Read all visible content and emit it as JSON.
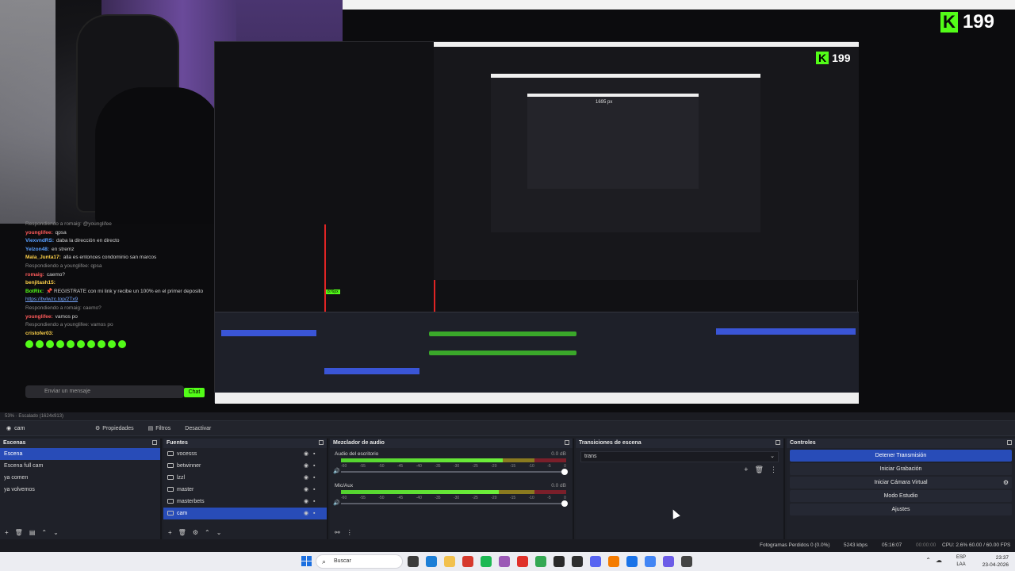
{
  "kick": {
    "count": "199"
  },
  "nested": {
    "size_label": "1695 px",
    "mini_count": "199",
    "chat_badge": "876px"
  },
  "chat": {
    "messages": [
      {
        "kind": "reply",
        "text": "Respondiendo a romaig: @younglifee"
      },
      {
        "kind": "msg",
        "user": "younglifee:",
        "text": "qpsa",
        "cls": "user-r"
      },
      {
        "kind": "msg",
        "user": "ViexvndRS:",
        "text": "daba la dirección en directo",
        "cls": "user-b"
      },
      {
        "kind": "msg",
        "user": "Yelzon48:",
        "text": "en stremz",
        "cls": "user-b"
      },
      {
        "kind": "msg",
        "user": "Mala_Junta17:",
        "text": "alla es entonces condominio san marcos",
        "cls": "user-y"
      },
      {
        "kind": "reply",
        "text": "Respondiendo a younglifee: qpsa"
      },
      {
        "kind": "msg",
        "user": "romaig:",
        "text": "caemo?",
        "cls": "user-r"
      },
      {
        "kind": "msg",
        "user": "benjitash15:",
        "text": "",
        "cls": "user-y"
      },
      {
        "kind": "msg",
        "user": "BotRix:",
        "text": "📌 REGISTRATE con mi link y recibe un 100% en el primer deposito",
        "cls": "user"
      },
      {
        "kind": "link",
        "text": "https://bvlwzc.top/2Tx9"
      },
      {
        "kind": "reply",
        "text": "Respondiendo a romaig: caemo?"
      },
      {
        "kind": "msg",
        "user": "younglifee:",
        "text": "vamos po",
        "cls": "user-r"
      },
      {
        "kind": "reply",
        "text": "Respondiendo a younglifee: vamos po"
      },
      {
        "kind": "msg",
        "user": "cristofer03:",
        "text": "",
        "cls": "user-y"
      }
    ],
    "input_placeholder": "Enviar un mensaje",
    "send_label": "Chat"
  },
  "status_strip": "53%  ·  Escalado (1624x913)",
  "props_bar": {
    "source": "cam",
    "properties": "Propiedades",
    "filters": "Filtros",
    "deactivate": "Desactivar"
  },
  "scenes": {
    "title": "Escenas",
    "items": [
      "Escena",
      "Escena full cam",
      "ya comen",
      "ya volvemos"
    ],
    "selected": 0
  },
  "sources": {
    "title": "Fuentes",
    "items": [
      "vocesss",
      "betwinner",
      "lzzl",
      "master",
      "masterbets",
      "cam"
    ],
    "selected": 5
  },
  "mixer": {
    "title": "Mezclador de audio",
    "channels": [
      {
        "name": "Audio del escritorio",
        "db": "0.0 dB",
        "level": 0.72
      },
      {
        "name": "Mic/Aux",
        "db": "0.0 dB",
        "level": 0.7
      }
    ],
    "ticks": [
      "-60",
      "-55",
      "-50",
      "-45",
      "-40",
      "-35",
      "-30",
      "-25",
      "-20",
      "-15",
      "-10",
      "-5",
      "0"
    ]
  },
  "transitions": {
    "title": "Transiciones de escena",
    "selected": "trans"
  },
  "controls": {
    "title": "Controles",
    "buttons": [
      "Detener Transmisión",
      "Iniciar Grabación",
      "Iniciar Cámara Virtual",
      "Modo Estudio",
      "Ajustes"
    ]
  },
  "statusbar": {
    "frames": "Fotogramas Perdidos 0 (0.0%)",
    "kbps": "5243 kbps",
    "time": "05:16:07",
    "rec": "00:00:00",
    "cpu": "CPU: 2.6%",
    "fps": "60.00 / 60.00 FPS"
  },
  "taskbar": {
    "search": "Buscar",
    "lang_top": "ESP",
    "lang_bottom": "LAA",
    "time": "23:37",
    "date": "23-04-2026"
  },
  "colors": {
    "accent": "#284cb8",
    "kick_green": "#53fc18",
    "rec_red": "#e02424"
  }
}
